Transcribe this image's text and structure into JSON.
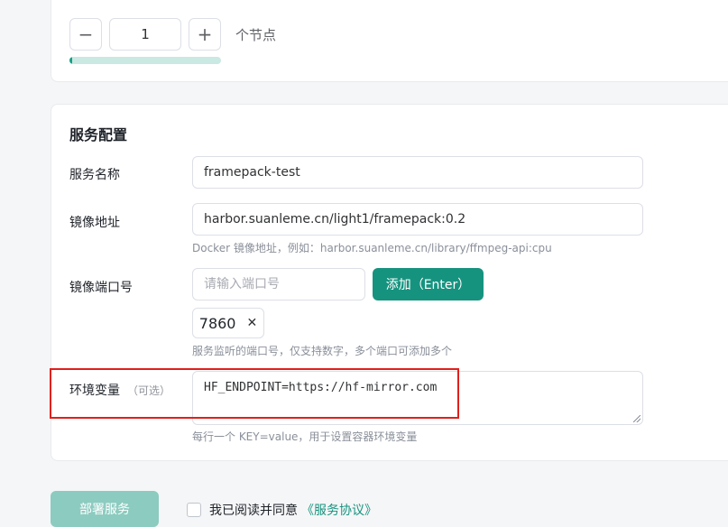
{
  "node_stepper": {
    "decrement_label": "−",
    "value": "1",
    "increment_label": "+",
    "unit_label": "个节点",
    "progress": 0.02
  },
  "service_config": {
    "title": "服务配置",
    "service_name": {
      "label": "服务名称",
      "value": "framepack-test"
    },
    "image_address": {
      "label": "镜像地址",
      "value": "harbor.suanleme.cn/light1/framepack:0.2",
      "hint": "Docker 镜像地址，例如：harbor.suanleme.cn/library/ffmpeg-api:cpu"
    },
    "image_port": {
      "label": "镜像端口号",
      "placeholder": "请输入端口号",
      "add_button": "添加（Enter）",
      "tags": [
        "7860"
      ],
      "tag_close": "✕",
      "hint": "服务监听的端口号，仅支持数字，多个端口可添加多个"
    },
    "env_vars": {
      "label": "环境变量",
      "optional": "（可选）",
      "value": "HF_ENDPOINT=https://hf-mirror.com",
      "hint": "每行一个 KEY=value，用于设置容器环境变量"
    }
  },
  "footer": {
    "deploy_button": "部署服务",
    "agree_text": "我已阅读并同意",
    "agreement_link": "《服务协议》"
  },
  "colors": {
    "primary": "#16937f",
    "primary_disabled": "#8ccbc0",
    "highlight_border": "#e0201c"
  }
}
